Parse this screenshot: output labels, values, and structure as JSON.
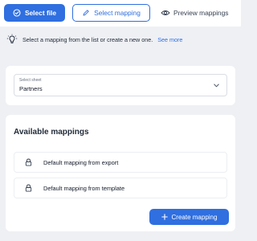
{
  "toolbar": {
    "select_file_label": "Select file",
    "select_mapping_label": "Select mapping",
    "preview_mappings_label": "Preview mappings"
  },
  "info": {
    "text": "Select a mapping from the list or create a new one.",
    "link_text": "See more"
  },
  "sheet": {
    "label": "Select sheet",
    "value": "Partners"
  },
  "mappings": {
    "title": "Available mappings",
    "items": [
      {
        "label": "Default mapping from export"
      },
      {
        "label": "Default mapping from template"
      }
    ],
    "create_label": "Create mapping"
  },
  "colors": {
    "accent": "#2f6fe0",
    "background": "#eef0f4",
    "card": "#ffffff"
  },
  "icons": {
    "select_file": "check-circle-icon",
    "select_mapping": "pencil-icon",
    "preview": "eye-icon",
    "info": "lightbulb-icon",
    "dropdown": "chevron-down-icon",
    "mapping_item": "lock-icon",
    "create": "plus-icon"
  }
}
